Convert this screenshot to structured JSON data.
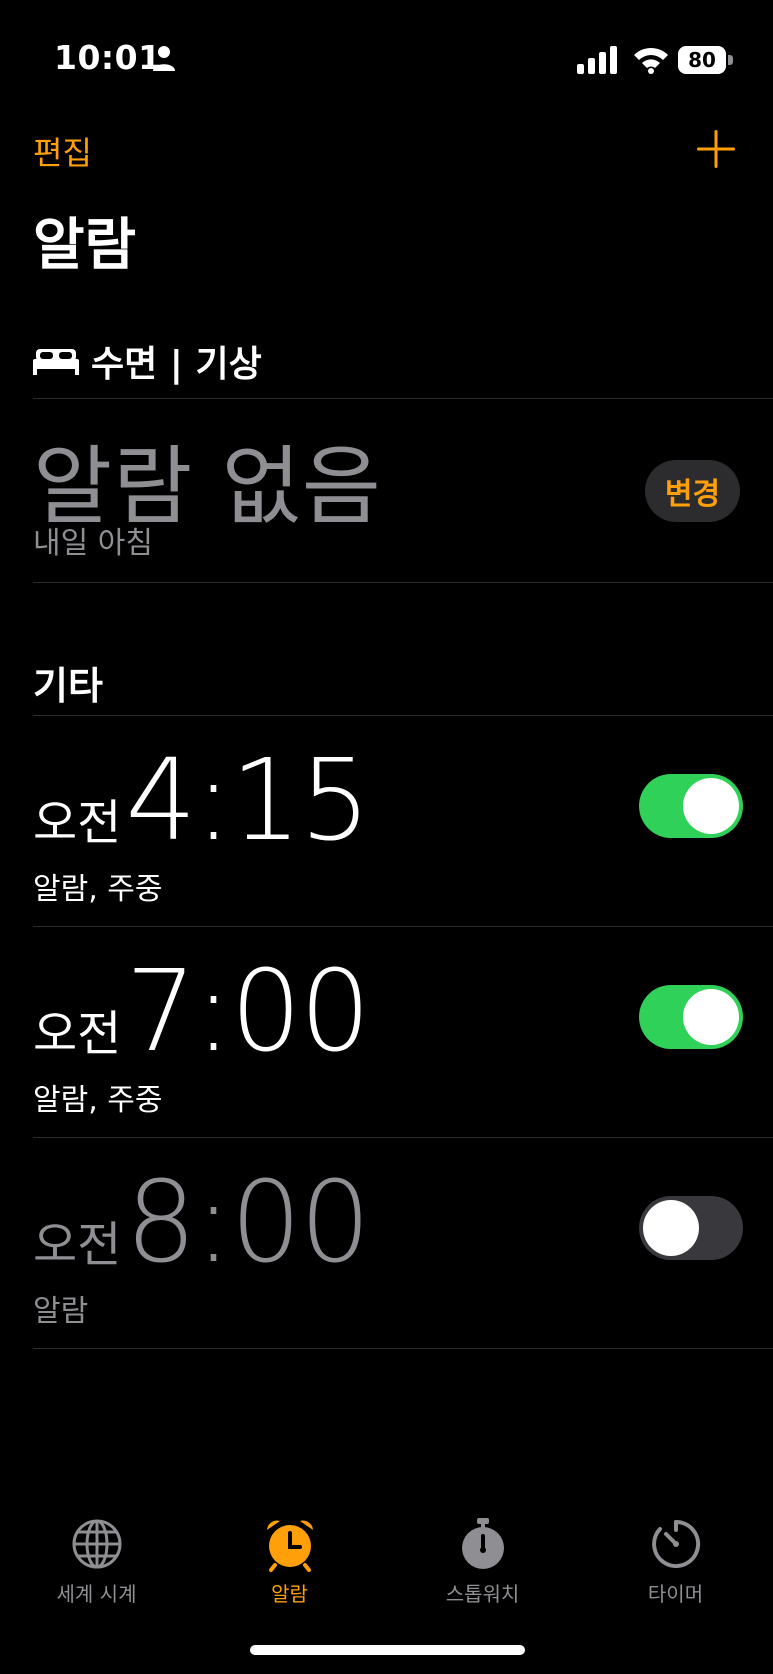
{
  "status_bar": {
    "time": "10:01",
    "battery": "80"
  },
  "header": {
    "edit_label": "편집",
    "title": "알람"
  },
  "sleep": {
    "title": "수면 | 기상",
    "no_alarm": "알람 없음",
    "subtitle": "내일 아침",
    "change_label": "변경"
  },
  "other": {
    "title": "기타",
    "alarms": [
      {
        "ampm": "오전",
        "time": "4:15",
        "label": "알람, 주중",
        "enabled": true
      },
      {
        "ampm": "오전",
        "time": "7:00",
        "label": "알람, 주중",
        "enabled": true
      },
      {
        "ampm": "오전",
        "time": "8:00",
        "label": "알람",
        "enabled": false
      }
    ]
  },
  "tabs": [
    {
      "label": "세계 시계",
      "icon": "globe-icon",
      "active": false
    },
    {
      "label": "알람",
      "icon": "alarm-clock-icon",
      "active": true
    },
    {
      "label": "스톱워치",
      "icon": "stopwatch-icon",
      "active": false
    },
    {
      "label": "타이머",
      "icon": "timer-icon",
      "active": false
    }
  ],
  "colors": {
    "accent": "#ff9f0a",
    "toggle_on": "#30d158",
    "secondary_text": "#8e8e93"
  }
}
